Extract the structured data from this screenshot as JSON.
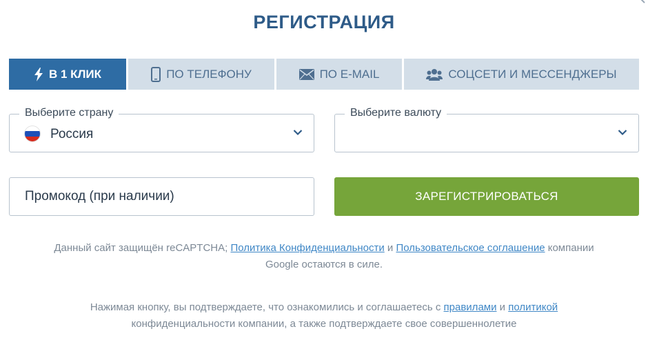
{
  "title": "РЕГИСТРАЦИЯ",
  "tabs": [
    {
      "label": "В 1 КЛИК",
      "icon": "lightning-icon",
      "active": true
    },
    {
      "label": "ПО ТЕЛЕФОНУ",
      "icon": "phone-icon",
      "active": false
    },
    {
      "label": "ПО E-MAIL",
      "icon": "envelope-icon",
      "active": false
    },
    {
      "label": "СОЦСЕТИ И МЕССЕНДЖЕРЫ",
      "icon": "users-icon",
      "active": false
    }
  ],
  "country": {
    "legend": "Выберите страну",
    "value": "Россия",
    "flag": "russia-flag-icon"
  },
  "currency": {
    "legend": "Выберите валюту",
    "value": ""
  },
  "promo": {
    "placeholder": "Промокод (при наличии)"
  },
  "register_button": "ЗАРЕГИСТРИРОВАТЬСЯ",
  "recaptcha_note": {
    "text1": "Данный сайт защищён reCAPTCHA; ",
    "link1": "Политика Конфиденциальности",
    "text2": " и ",
    "link2": "Пользовательское соглашение",
    "text3": " компании",
    "line2": "Google остаются в силе."
  },
  "terms_note": {
    "text1": "Нажимая кнопку, вы подтверждаете, что ознакомились и соглашаетесь с ",
    "link1": "правилами",
    "text2": " и ",
    "link2": "политикой",
    "line2": "конфиденциальности компании, а также подтверждаете свое совершеннолетие"
  },
  "colors": {
    "title": "#2e5b88",
    "tab_active": "#2e6ca4",
    "tab_inactive": "#d3dee8",
    "register": "#76a53a",
    "link": "#3f87c6"
  }
}
